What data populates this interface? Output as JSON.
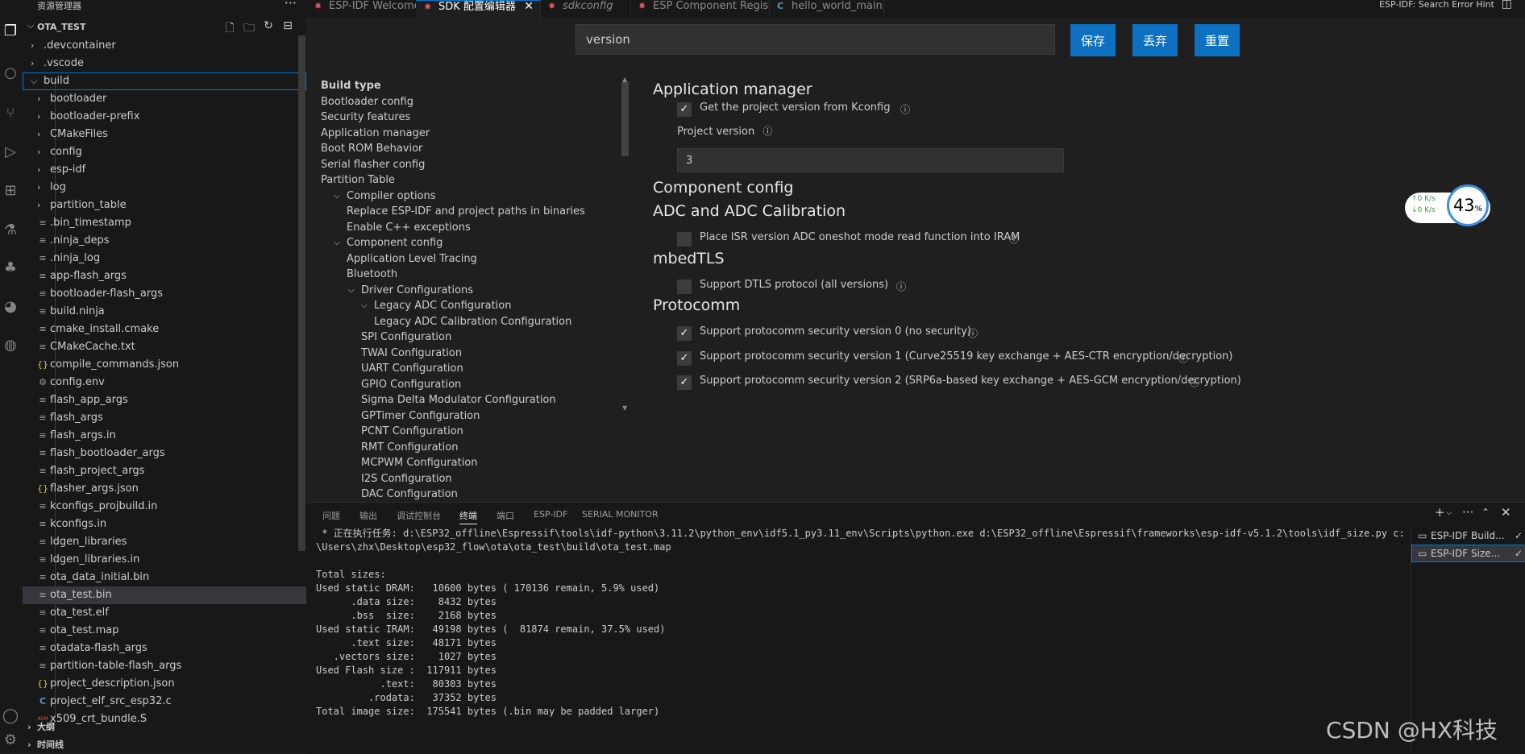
{
  "sidebar": {
    "title": "资源管理器",
    "more": "···",
    "project": "OTA_TEST",
    "tree": [
      {
        "label": ".devcontainer",
        "type": "folder",
        "level": 0,
        "expanded": false
      },
      {
        "label": ".vscode",
        "type": "folder",
        "level": 0,
        "expanded": false
      },
      {
        "label": "build",
        "type": "folder",
        "level": 0,
        "expanded": true,
        "focused": true
      },
      {
        "label": "bootloader",
        "type": "folder",
        "level": 1,
        "expanded": false
      },
      {
        "label": "bootloader-prefix",
        "type": "folder",
        "level": 1,
        "expanded": false
      },
      {
        "label": "CMakeFiles",
        "type": "folder",
        "level": 1,
        "expanded": false
      },
      {
        "label": "config",
        "type": "folder",
        "level": 1,
        "expanded": false
      },
      {
        "label": "esp-idf",
        "type": "folder",
        "level": 1,
        "expanded": false
      },
      {
        "label": "log",
        "type": "folder",
        "level": 1,
        "expanded": false
      },
      {
        "label": "partition_table",
        "type": "folder",
        "level": 1,
        "expanded": false
      },
      {
        "label": ".bin_timestamp",
        "type": "file",
        "level": 1
      },
      {
        "label": ".ninja_deps",
        "type": "file",
        "level": 1
      },
      {
        "label": ".ninja_log",
        "type": "file",
        "level": 1
      },
      {
        "label": "app-flash_args",
        "type": "file",
        "level": 1
      },
      {
        "label": "bootloader-flash_args",
        "type": "file",
        "level": 1
      },
      {
        "label": "build.ninja",
        "type": "file",
        "level": 1
      },
      {
        "label": "cmake_install.cmake",
        "type": "file",
        "level": 1
      },
      {
        "label": "CMakeCache.txt",
        "type": "file",
        "level": 1
      },
      {
        "label": "compile_commands.json",
        "type": "json",
        "level": 1
      },
      {
        "label": "config.env",
        "type": "gear",
        "level": 1
      },
      {
        "label": "flash_app_args",
        "type": "file",
        "level": 1
      },
      {
        "label": "flash_args",
        "type": "file",
        "level": 1
      },
      {
        "label": "flash_args.in",
        "type": "file",
        "level": 1
      },
      {
        "label": "flash_bootloader_args",
        "type": "file",
        "level": 1
      },
      {
        "label": "flash_project_args",
        "type": "file",
        "level": 1
      },
      {
        "label": "flasher_args.json",
        "type": "json",
        "level": 1
      },
      {
        "label": "kconfigs_projbuild.in",
        "type": "file",
        "level": 1
      },
      {
        "label": "kconfigs.in",
        "type": "file",
        "level": 1
      },
      {
        "label": "ldgen_libraries",
        "type": "file",
        "level": 1
      },
      {
        "label": "ldgen_libraries.in",
        "type": "file",
        "level": 1
      },
      {
        "label": "ota_data_initial.bin",
        "type": "file",
        "level": 1
      },
      {
        "label": "ota_test.bin",
        "type": "file",
        "level": 1,
        "selected": true
      },
      {
        "label": "ota_test.elf",
        "type": "file",
        "level": 1
      },
      {
        "label": "ota_test.map",
        "type": "file",
        "level": 1
      },
      {
        "label": "otadata-flash_args",
        "type": "file",
        "level": 1
      },
      {
        "label": "partition-table-flash_args",
        "type": "file",
        "level": 1
      },
      {
        "label": "project_description.json",
        "type": "json",
        "level": 1
      },
      {
        "label": "project_elf_src_esp32.c",
        "type": "c",
        "level": 1
      },
      {
        "label": "x509_crt_bundle.S",
        "type": "asm",
        "level": 1
      }
    ],
    "outline": "大纲",
    "timeline": "时间线"
  },
  "tabs": [
    {
      "label": "ESP-IDF Welcome",
      "icon": "esp",
      "active": false
    },
    {
      "label": "SDK 配置编辑器",
      "icon": "esp",
      "active": true
    },
    {
      "label": "sdkconfig",
      "icon": "esp",
      "active": false,
      "italic": true
    },
    {
      "label": "ESP Component Registry",
      "icon": "esp",
      "active": false
    },
    {
      "label": "hello_world_main.c",
      "icon": "c",
      "active": false
    }
  ],
  "hint": "ESP-IDF: Search Error Hint",
  "sdk": {
    "search_value": "version",
    "buttons": {
      "save": "保存",
      "discard": "丢弃",
      "reset": "重置"
    },
    "nav": [
      {
        "label": "Build type",
        "level": 0,
        "bold": true
      },
      {
        "label": "Bootloader config",
        "level": 0
      },
      {
        "label": "Security features",
        "level": 0
      },
      {
        "label": "Application manager",
        "level": 0
      },
      {
        "label": "Boot ROM Behavior",
        "level": 0
      },
      {
        "label": "Serial flasher config",
        "level": 0
      },
      {
        "label": "Partition Table",
        "level": 0
      },
      {
        "label": "Compiler options",
        "level": 1,
        "chev": true
      },
      {
        "label": "Replace ESP-IDF and project paths in binaries",
        "level": 1
      },
      {
        "label": "Enable C++ exceptions",
        "level": 1
      },
      {
        "label": "Component config",
        "level": 1,
        "chev": true
      },
      {
        "label": "Application Level Tracing",
        "level": 1
      },
      {
        "label": "Bluetooth",
        "level": 1
      },
      {
        "label": "Driver Configurations",
        "level": 2,
        "chev": true
      },
      {
        "label": "Legacy ADC Configuration",
        "level": 3,
        "chev": true
      },
      {
        "label": "Legacy ADC Calibration Configuration",
        "level": 3
      },
      {
        "label": "SPI Configuration",
        "level": 2
      },
      {
        "label": "TWAI Configuration",
        "level": 2
      },
      {
        "label": "UART Configuration",
        "level": 2
      },
      {
        "label": "GPIO Configuration",
        "level": 2
      },
      {
        "label": "Sigma Delta Modulator Configuration",
        "level": 2
      },
      {
        "label": "GPTimer Configuration",
        "level": 2
      },
      {
        "label": "PCNT Configuration",
        "level": 2
      },
      {
        "label": "RMT Configuration",
        "level": 2
      },
      {
        "label": "MCPWM Configuration",
        "level": 2
      },
      {
        "label": "I2S Configuration",
        "level": 2
      },
      {
        "label": "DAC Configuration",
        "level": 2
      }
    ],
    "sections": {
      "app_manager": "Application manager",
      "app_opt": "Get the project version from Kconfig",
      "project_version_label": "Project version",
      "project_version_value": "3",
      "component_config": "Component config",
      "adc": "ADC and ADC Calibration",
      "adc_opt": "Place ISR version ADC oneshot mode read function into IRAM",
      "mbedtls": "mbedTLS",
      "mbedtls_opt": "Support DTLS protocol (all versions)",
      "protocomm": "Protocomm",
      "proto_opt0": "Support protocomm security version 0 (no security)",
      "proto_opt1": "Support protocomm security version 1 (Curve25519 key exchange + AES-CTR encryption/decryption)",
      "proto_opt2": "Support protocomm security version 2 (SRP6a-based key exchange + AES-GCM encryption/decryption)"
    },
    "checks": {
      "app_opt": true,
      "adc_opt": false,
      "mbedtls_opt": false,
      "proto_opt0": true,
      "proto_opt1": true,
      "proto_opt2": true
    }
  },
  "net": {
    "up": "↑0  K/s",
    "down": "↓0  K/s",
    "percent": "43",
    "unit": "%"
  },
  "panel": {
    "tabs": [
      "问题",
      "输出",
      "调试控制台",
      "终端",
      "端口",
      "ESP-IDF",
      "SERIAL MONITOR"
    ],
    "active_tab": "终端",
    "terminal_lines": [
      " * 正在执行任务: d:\\ESP32_offline\\Espressif\\tools\\idf-python\\3.11.2\\python_env\\idf5.1_py3.11_env\\Scripts\\python.exe d:\\ESP32_offline\\Espressif\\frameworks\\esp-idf-v5.1.2\\tools\\idf_size.py c:",
      "\\Users\\zhx\\Desktop\\esp32_flow\\ota\\ota_test\\build\\ota_test.map",
      "",
      "Total sizes:",
      "Used static DRAM:   10600 bytes ( 170136 remain, 5.9% used)",
      "      .data size:    8432 bytes",
      "      .bss  size:    2168 bytes",
      "Used static IRAM:   49198 bytes (  81874 remain, 37.5% used)",
      "      .text size:   48171 bytes",
      "   .vectors size:    1027 bytes",
      "Used Flash size :  117911 bytes",
      "           .text:   80303 bytes",
      "         .rodata:   37352 bytes",
      "Total image size:  175541 bytes (.bin may be padded larger)"
    ],
    "term_list": [
      "ESP-IDF Build...",
      "ESP-IDF Size..."
    ]
  },
  "watermark": "CSDN @HX科技"
}
